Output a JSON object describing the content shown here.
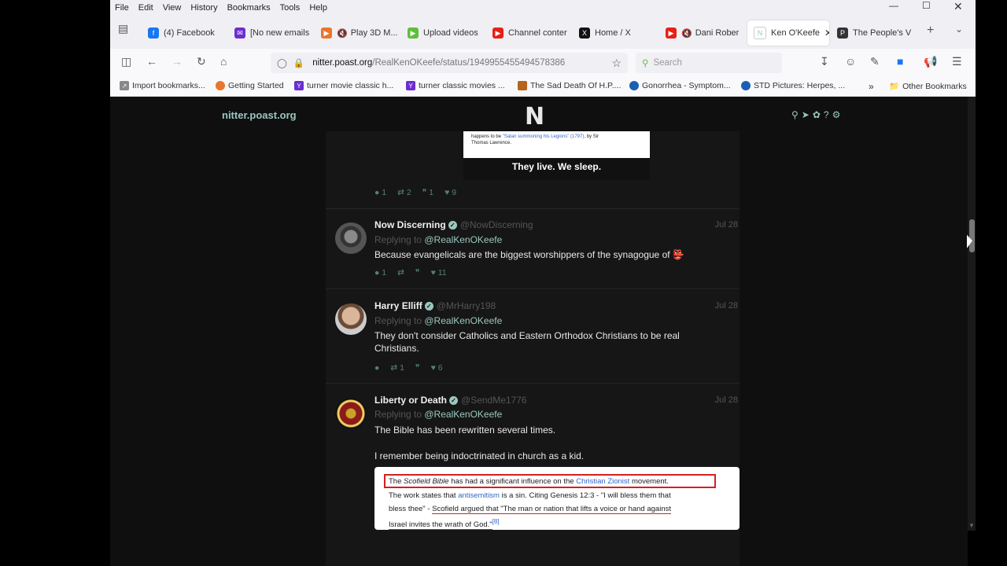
{
  "menu": [
    "File",
    "Edit",
    "View",
    "History",
    "Bookmarks",
    "Tools",
    "Help"
  ],
  "tabs": [
    {
      "label": "(4) Facebook",
      "icon": "facebook-icon",
      "color": "#1877f2"
    },
    {
      "label": "[No new emails",
      "icon": "mail-icon",
      "color": "#6b2ecf"
    },
    {
      "label": "Play 3D M...",
      "icon": "game-icon",
      "color": "#e8762c"
    },
    {
      "label": "Upload videos",
      "icon": "rumble-icon",
      "color": "#5fbe3c"
    },
    {
      "label": "Channel conter",
      "icon": "youtube-icon",
      "color": "#e62117"
    },
    {
      "label": "Home / X",
      "icon": "x-icon",
      "color": "#111111"
    },
    {
      "label": "Dani Rober",
      "icon": "youtube-icon",
      "color": "#e62117"
    },
    {
      "label": "Ken O'Keefe",
      "icon": "nitter-icon",
      "color": "#ffffff"
    },
    {
      "label": "The People's V",
      "icon": "people-icon",
      "color": "#333333"
    }
  ],
  "url": {
    "host": "nitter.poast.org",
    "path": "/RealKenOKeefe/status/1949955455494578386"
  },
  "search_placeholder": "Search",
  "bookmarks": [
    {
      "label": "Import bookmarks...",
      "color": "#666666"
    },
    {
      "label": "Getting Started",
      "color": "#e8762c"
    },
    {
      "label": "turner movie classic h...",
      "color": "#6b2ecf"
    },
    {
      "label": "turner classic movies ...",
      "color": "#6b2ecf"
    },
    {
      "label": "The Sad Death Of H.P....",
      "color": "#b5651d"
    },
    {
      "label": "Gonorrhea - Symptom...",
      "color": "#1a5fb4"
    },
    {
      "label": "STD Pictures: Herpes, ...",
      "color": "#1a5fb4"
    }
  ],
  "other_bookmarks": "Other Bookmarks",
  "site_name": "nitter.poast.org",
  "site_logo": "N",
  "quote_image": {
    "caption_line1": "happens to be ",
    "caption_link": "\"Satan summoning his Legions\" (1797)",
    "caption_line1b": ", by Sir",
    "caption_line2": "Thomas Lawrence.",
    "headline": "They live.  We sleep."
  },
  "first_stats": {
    "replies": "1",
    "retweets": "2",
    "quotes": "1",
    "likes": "9"
  },
  "tweets": [
    {
      "name": "Now Discerning",
      "handle": "@NowDiscerning",
      "date": "Jul 28",
      "reply_prefix": "Replying to ",
      "reply_to": "@RealKenOKeefe",
      "text": "Because evangelicals are the biggest worshippers of the synagogue of 👺",
      "stats": {
        "replies": "1",
        "retweets": "",
        "quotes": "",
        "likes": "11"
      }
    },
    {
      "name": "Harry Elliff",
      "handle": "@MrHarry198",
      "date": "Jul 28",
      "reply_prefix": "Replying to ",
      "reply_to": "@RealKenOKeefe",
      "text": "They don't consider Catholics and Eastern Orthodox Christians to be real Christians.",
      "stats": {
        "replies": "",
        "retweets": "1",
        "quotes": "",
        "likes": "6"
      }
    },
    {
      "name": "Liberty or Death",
      "handle": "@SendMe1776",
      "date": "Jul 28",
      "reply_prefix": "Replying to ",
      "reply_to": "@RealKenOKeefe",
      "text": "The Bible has been rewritten several times.",
      "text2": "I remember being indoctrinated in church as a kid."
    }
  ],
  "wiki": {
    "l1a": "The ",
    "l1b": "Scofield Bible",
    "l1c": " has had a significant influence on the ",
    "l1d": "Christian Zionist",
    "l1e": " movement.",
    "l2a": "The work states that ",
    "l2b": "antisemitism",
    "l2c": " is a sin. Citing Genesis 12:3 - \"I will bless them that",
    "l3a": "bless thee\" - ",
    "l3b": "Scofield argued that \"The man or nation that lifts a voice or hand against",
    "l4a": "Israel invites the wrath of God.\"",
    "l4b": "[8]"
  }
}
